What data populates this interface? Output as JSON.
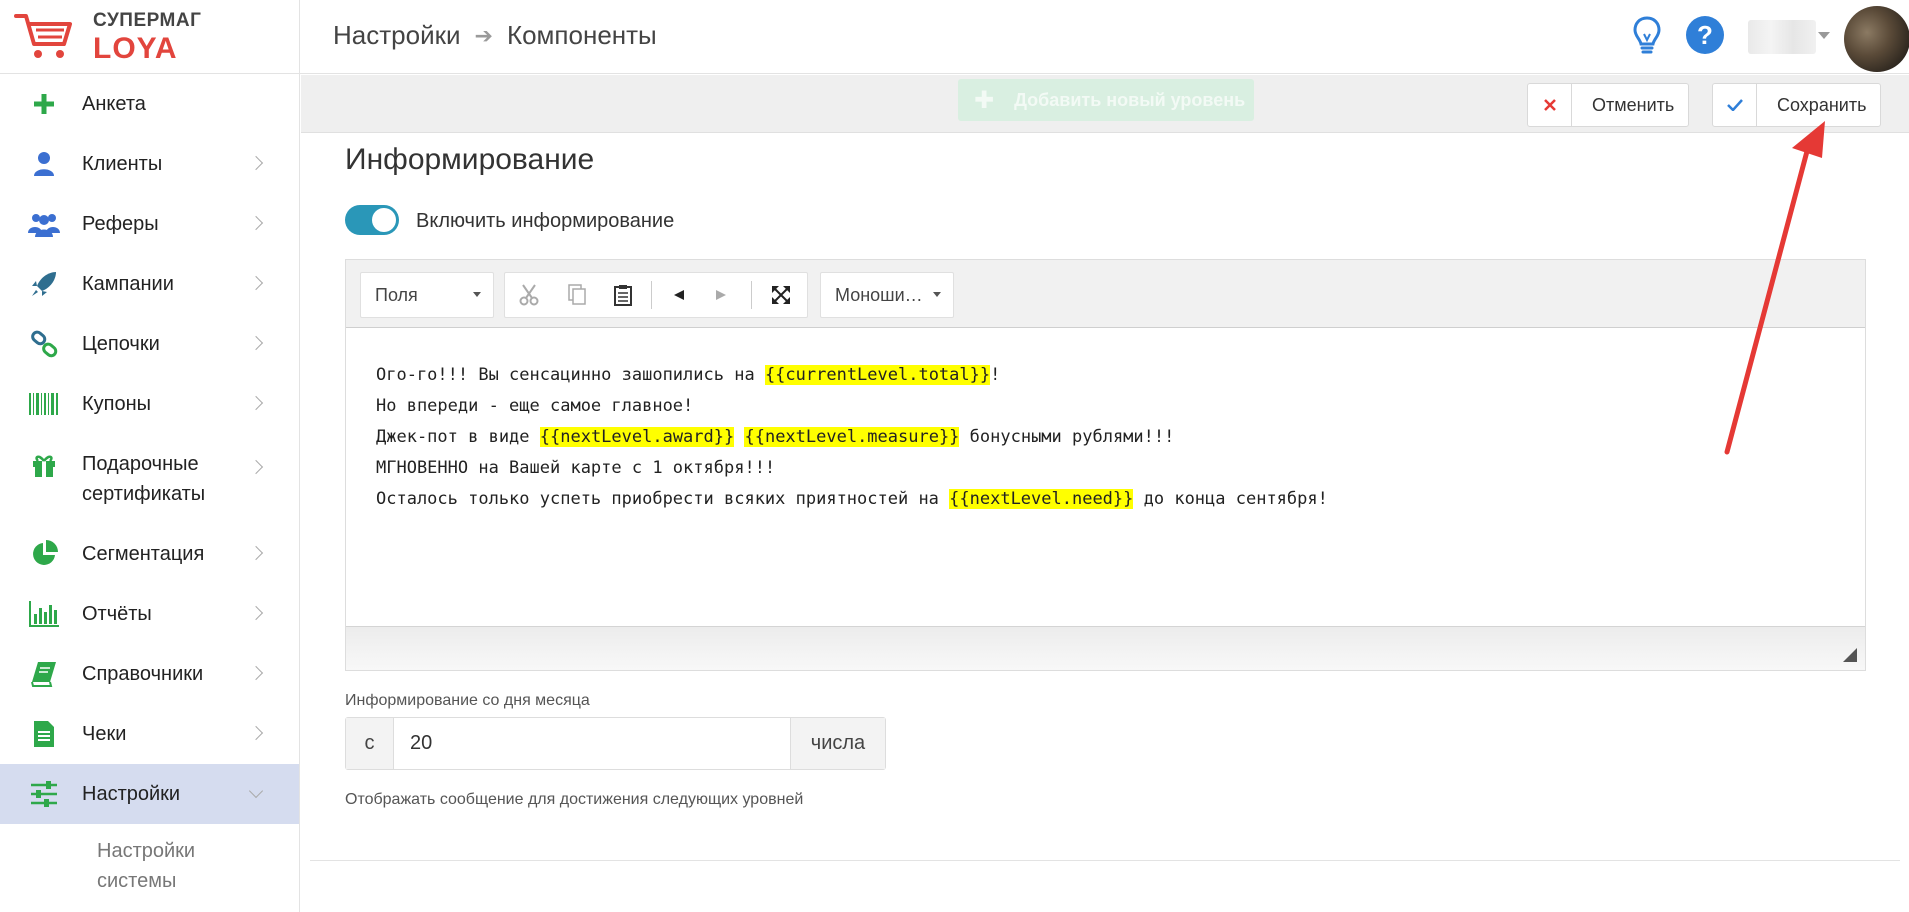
{
  "app": {
    "logo_top": "СУПЕРМАГ",
    "logo_bottom": "LOYA"
  },
  "breadcrumb": {
    "parent": "Настройки",
    "current": "Компоненты"
  },
  "header": {
    "hint_icon": "lightbulb-icon",
    "help_icon": "question-circle-icon"
  },
  "sidebar": {
    "items": [
      {
        "label": "Анкета",
        "icon": "plus-icon",
        "chevron": false
      },
      {
        "label": "Клиенты",
        "icon": "user-icon",
        "chevron": true
      },
      {
        "label": "Реферы",
        "icon": "users-icon",
        "chevron": true
      },
      {
        "label": "Кампании",
        "icon": "rocket-icon",
        "chevron": true
      },
      {
        "label": "Цепочки",
        "icon": "chain-icon",
        "chevron": true
      },
      {
        "label": "Купоны",
        "icon": "barcode-icon",
        "chevron": true
      },
      {
        "label_line1": "Подарочные",
        "label_line2": "сертификаты",
        "icon": "gift-icon",
        "chevron": true
      },
      {
        "label": "Сегментация",
        "icon": "pie-chart-icon",
        "chevron": true
      },
      {
        "label": "Отчёты",
        "icon": "bar-chart-icon",
        "chevron": true
      },
      {
        "label": "Справочники",
        "icon": "book-icon",
        "chevron": true
      },
      {
        "label": "Чеки",
        "icon": "receipt-icon",
        "chevron": true
      },
      {
        "label": "Настройки",
        "icon": "sliders-icon",
        "chevron": true,
        "active": true
      }
    ],
    "sub_item_line1": "Настройки",
    "sub_item_line2": "системы"
  },
  "actions": {
    "add_level": "Добавить новый уровень",
    "cancel": "Отменить",
    "save": "Сохранить"
  },
  "section": {
    "title": "Информирование",
    "toggle_label": "Включить информирование",
    "toggle_on": true
  },
  "editor": {
    "fields_select": "Поля",
    "font_select": "Моноши…",
    "lines": [
      [
        "Ого-го!!! Вы сенсацинно зашопились на ",
        {
          "hl": "{{currentLevel.total}}"
        },
        "!"
      ],
      [
        "Но впереди - еще самое главное!"
      ],
      [
        "Джек-пот в виде ",
        {
          "hl": "{{nextLevel.award}}"
        },
        " ",
        {
          "hl": "{{nextLevel.measure}}"
        },
        " бонусными рублями!!!"
      ],
      [
        "МГНОВЕННО на Вашей карте с 1 октября!!!"
      ],
      [
        "Осталось только успеть приобрести всяких приятностей на ",
        {
          "hl": "{{nextLevel.need}}"
        },
        " до конца сентября!"
      ]
    ]
  },
  "day_field": {
    "label": "Информирование со дня месяца",
    "prefix": "с",
    "value": "20",
    "suffix": "числа"
  },
  "note": "Отображать сообщение для достижения следующих уровней",
  "colors": {
    "accent": "#2a97b8",
    "logo_red": "#e2453d",
    "nav_icon_green": "#2ea84a",
    "nav_icon_blue": "#3b6fd1",
    "active_bg": "#d5dcef",
    "highlight": "#ffff00",
    "annotation_arrow": "#e53935"
  }
}
